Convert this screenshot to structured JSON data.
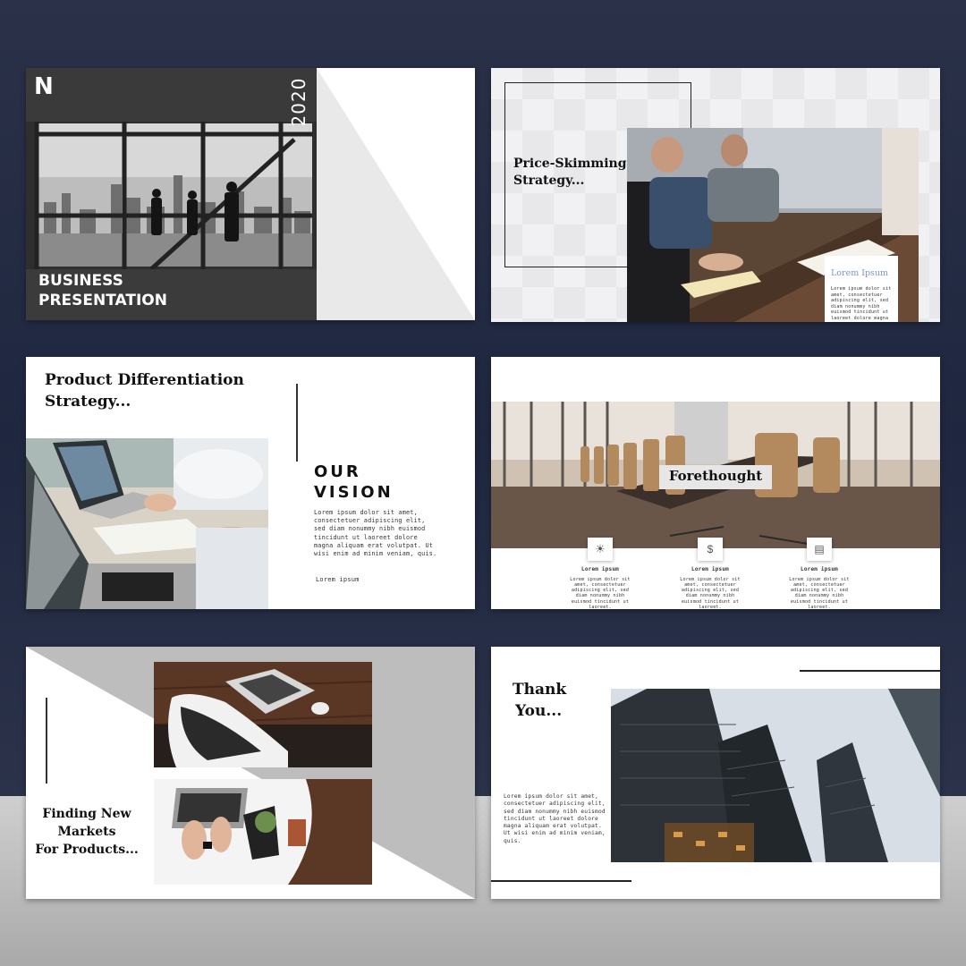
{
  "slide1": {
    "logo": "N",
    "year": "2020",
    "title_line1": "BUSINESS",
    "title_line2": "PRESENTATION"
  },
  "slide2": {
    "title_line1": "Price-Skimming",
    "title_line2": "Strategy...",
    "card_title": "Lorem Ipsum",
    "card_text": "Lorem ipsum dolor sit amet, consectetuer adipiscing elit, sed diam nonummy nibh euismod tincidunt ut laoreet dolore magna aliquam erat volutpat. Ut wisi enim ad minim veniam, quis."
  },
  "slide3": {
    "title_line1": "Product Differentiation",
    "title_line2": "Strategy...",
    "heading_line1": "OUR",
    "heading_line2": "VISION",
    "body": "Lorem ipsum dolor sit amet, consectetuer adipiscing elit, sed diam nonummy nibh euismod tincidunt ut laoreet dolore magna aliquam erat volutpat. Ut wisi enim ad minim veniam, quis.",
    "footer": "Lorem ipsum"
  },
  "slide4": {
    "banner": "Forethought",
    "items": [
      {
        "icon": "lightbulb-icon",
        "title": "Lorem ipsum",
        "text": "Lorem ipsum dolor sit amet, consectetuer adipiscing elit, sed diam nonummy nibh euismod tincidunt ut laoreet."
      },
      {
        "icon": "money-icon",
        "title": "Lorem ipsum",
        "text": "Lorem ipsum dolor sit amet, consectetuer adipiscing elit, sed diam nonummy nibh euismod tincidunt ut laoreet."
      },
      {
        "icon": "document-icon",
        "title": "Lorem ipsum",
        "text": "Lorem ipsum dolor sit amet, consectetuer adipiscing elit, sed diam nonummy nibh euismod tincidunt ut laoreet."
      }
    ]
  },
  "slide5": {
    "title_line1": "Finding New",
    "title_line2": "Markets",
    "title_line3": "For Products..."
  },
  "slide6": {
    "title_line1": "Thank",
    "title_line2": "You...",
    "body": "Lorem ipsum dolor sit amet, consectetuer adipiscing elit, sed diam nonummy nibh euismod tincidunt ut laoreet dolore magna aliquam erat volutpat. Ut wisi enim ad minim veniam, quis."
  }
}
